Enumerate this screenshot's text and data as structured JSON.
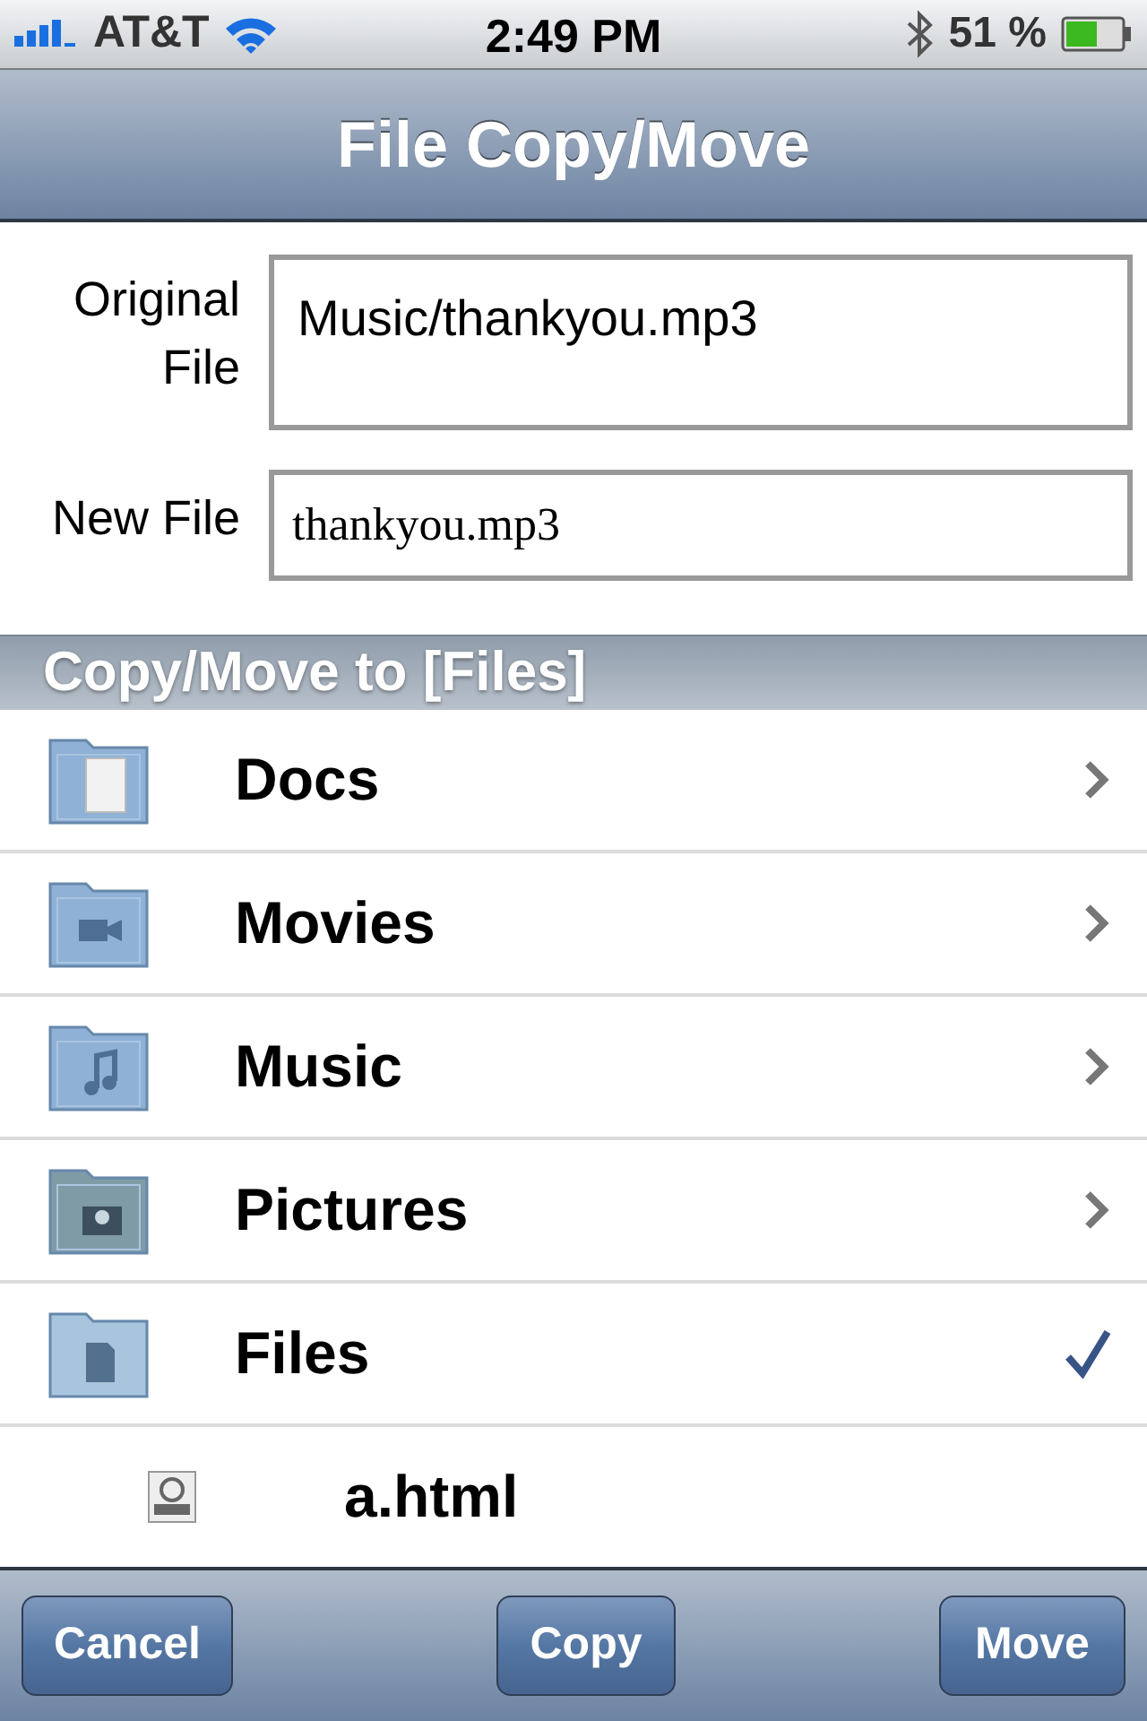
{
  "status_bar": {
    "carrier": "AT&T",
    "time": "2:49 PM",
    "battery": "51 %"
  },
  "nav_bar": {
    "title": "File Copy/Move"
  },
  "form": [
    {
      "label": "Original File",
      "value": "Music/thankyou.mp3",
      "kind": "area"
    },
    {
      "label": "New File",
      "value": "thankyou.mp3",
      "kind": "input"
    }
  ],
  "section_header": "Copy/Move to [Files]",
  "folders": [
    {
      "name": "Docs",
      "selected": false
    },
    {
      "name": "Movies",
      "selected": false
    },
    {
      "name": "Music",
      "selected": false
    },
    {
      "name": "Pictures",
      "selected": false
    },
    {
      "name": "Files",
      "selected": true,
      "children": [
        {
          "name": "a.html"
        }
      ]
    }
  ],
  "toolbar": [
    "Cancel",
    "Copy",
    "Move"
  ]
}
